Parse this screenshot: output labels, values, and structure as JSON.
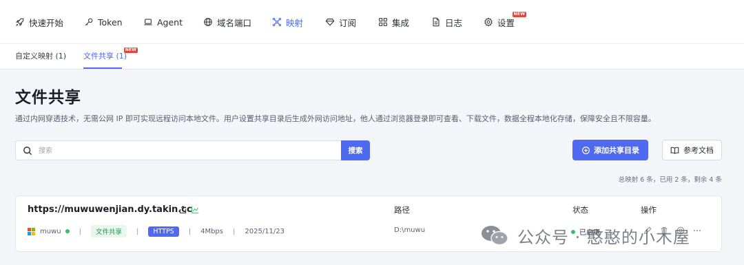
{
  "nav": {
    "items": [
      {
        "label": "快速开始",
        "icon": "rocket-icon"
      },
      {
        "label": "Token",
        "icon": "key-icon"
      },
      {
        "label": "Agent",
        "icon": "laptop-icon"
      },
      {
        "label": "域名端口",
        "icon": "globe-icon"
      },
      {
        "label": "映射",
        "icon": "mapping-icon",
        "active": true
      },
      {
        "label": "订阅",
        "icon": "diamond-icon"
      },
      {
        "label": "集成",
        "icon": "grid-icon"
      },
      {
        "label": "日志",
        "icon": "document-icon"
      },
      {
        "label": "设置",
        "icon": "gear-icon",
        "badge": "NEW"
      }
    ]
  },
  "subtabs": {
    "items": [
      {
        "label": "自定义映射 (1)"
      },
      {
        "label": "文件共享 (1)",
        "active": true,
        "badge": "NEW"
      }
    ]
  },
  "page": {
    "title": "文件共享",
    "description": "通过内网穿透技术，无需公网 IP 即可实现远程访问本地文件。用户设置共享目录后生成外网访问地址，他人通过浏览器登录即可查看、下载文件，数据全程本地化存储，保障安全且不限容量。"
  },
  "search": {
    "placeholder": "搜索",
    "button": "搜索"
  },
  "actions": {
    "add_label": "添加共享目录",
    "doc_label": "参考文档"
  },
  "summary": "总映射 6 条，已用 2 条，剩余 4 条",
  "card": {
    "domain": "https://muwuwenjian.dy.takin.cc",
    "col_path": "路径",
    "col_status": "状态",
    "col_ops": "操作",
    "agent": "muwu",
    "type_tag": "文件共享",
    "protocol_tag": "HTTPS",
    "bandwidth": "4Mbps",
    "date": "2025/11/23",
    "path": "D:\\muwu",
    "status": "已启用",
    "sep": "|"
  },
  "watermark": {
    "text": "公众号 · 憨憨的小木屋"
  },
  "colors": {
    "accent": "#4f6af0",
    "status_green": "#34c06b",
    "badge_red": "#e2463b"
  }
}
